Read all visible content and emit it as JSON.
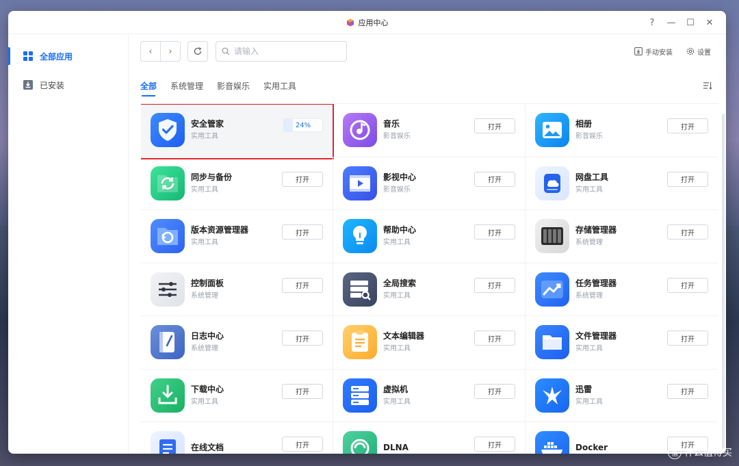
{
  "window": {
    "title": "应用中心",
    "controls": {
      "help": "?",
      "minimize": "—",
      "maximize": "☐",
      "close": "✕"
    }
  },
  "sidebar": {
    "items": [
      {
        "label": "全部应用",
        "icon": "grid-icon",
        "active": true
      },
      {
        "label": "已安装",
        "icon": "download-box-icon",
        "active": false
      }
    ]
  },
  "toolbar": {
    "back": "‹",
    "forward": "›",
    "search_placeholder": "请输入",
    "manual_install": "手动安装",
    "settings": "设置"
  },
  "tabs": [
    {
      "label": "全部",
      "active": true
    },
    {
      "label": "系统管理",
      "active": false
    },
    {
      "label": "影音娱乐",
      "active": false
    },
    {
      "label": "实用工具",
      "active": false
    }
  ],
  "open_label": "打开",
  "apps": [
    {
      "name": "安全管家",
      "category": "实用工具",
      "icon": "shield-check-icon",
      "progress": "24%",
      "progress_value": 0.24
    },
    {
      "name": "音乐",
      "category": "影音娱乐",
      "icon": "music-disc-icon"
    },
    {
      "name": "相册",
      "category": "影音娱乐",
      "icon": "photo-icon"
    },
    {
      "name": "同步与备份",
      "category": "实用工具",
      "icon": "sync-folder-icon"
    },
    {
      "name": "影视中心",
      "category": "影音娱乐",
      "icon": "film-play-icon"
    },
    {
      "name": "网盘工具",
      "category": "实用工具",
      "icon": "cloud-drive-icon"
    },
    {
      "name": "版本资源管理器",
      "category": "实用工具",
      "icon": "version-history-icon"
    },
    {
      "name": "帮助中心",
      "category": "实用工具",
      "icon": "lightbulb-icon"
    },
    {
      "name": "存储管理器",
      "category": "系统管理",
      "icon": "storage-drives-icon"
    },
    {
      "name": "控制面板",
      "category": "系统管理",
      "icon": "sliders-icon"
    },
    {
      "name": "全局搜索",
      "category": "实用工具",
      "icon": "server-search-icon"
    },
    {
      "name": "任务管理器",
      "category": "系统管理",
      "icon": "trend-chart-icon"
    },
    {
      "name": "日志中心",
      "category": "系统管理",
      "icon": "log-book-icon"
    },
    {
      "name": "文本编辑器",
      "category": "实用工具",
      "icon": "notepad-icon"
    },
    {
      "name": "文件管理器",
      "category": "实用工具",
      "icon": "folder-icon"
    },
    {
      "name": "下载中心",
      "category": "实用工具",
      "icon": "download-tray-icon"
    },
    {
      "name": "虚拟机",
      "category": "实用工具",
      "icon": "server-stack-icon"
    },
    {
      "name": "迅雷",
      "category": "实用工具",
      "icon": "thunder-bird-icon"
    },
    {
      "name": "在线文档",
      "category": "",
      "icon": "document-icon"
    },
    {
      "name": "DLNA",
      "category": "",
      "icon": "dlna-icon"
    },
    {
      "name": "Docker",
      "category": "",
      "icon": "docker-whale-icon"
    }
  ],
  "watermark": {
    "text": "什么值得买",
    "badge": "值"
  }
}
